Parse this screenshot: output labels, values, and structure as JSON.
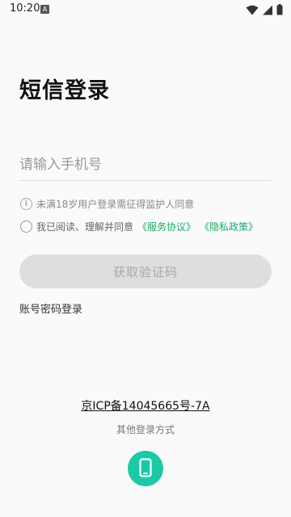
{
  "status_bar": {
    "time": "10:20",
    "notification_icon": "a-notification-icon",
    "wifi_icon": "wifi-icon",
    "signal_icon": "cell-signal-icon",
    "battery_icon": "battery-icon"
  },
  "page": {
    "title": "短信登录"
  },
  "phone_input": {
    "value": "",
    "placeholder": "请输入手机号"
  },
  "notice": {
    "icon": "info-icon",
    "text": "未满18岁用户登录需征得监护人同意"
  },
  "agreement": {
    "checked": false,
    "prefix": "我已阅读、理解并同意",
    "service_link": "《服务协议》",
    "privacy_link": "《隐私政策》",
    "link_color": "#1aab6c"
  },
  "get_code_button": {
    "label": "获取验证码",
    "enabled": false
  },
  "password_login_link": "账号密码登录",
  "icp_text": "京ICP备14045665号-7A",
  "other_login": {
    "label": "其他登录方式",
    "phone_button_icon": "mobile-phone-icon",
    "phone_button_color": "#1cc9a6"
  }
}
